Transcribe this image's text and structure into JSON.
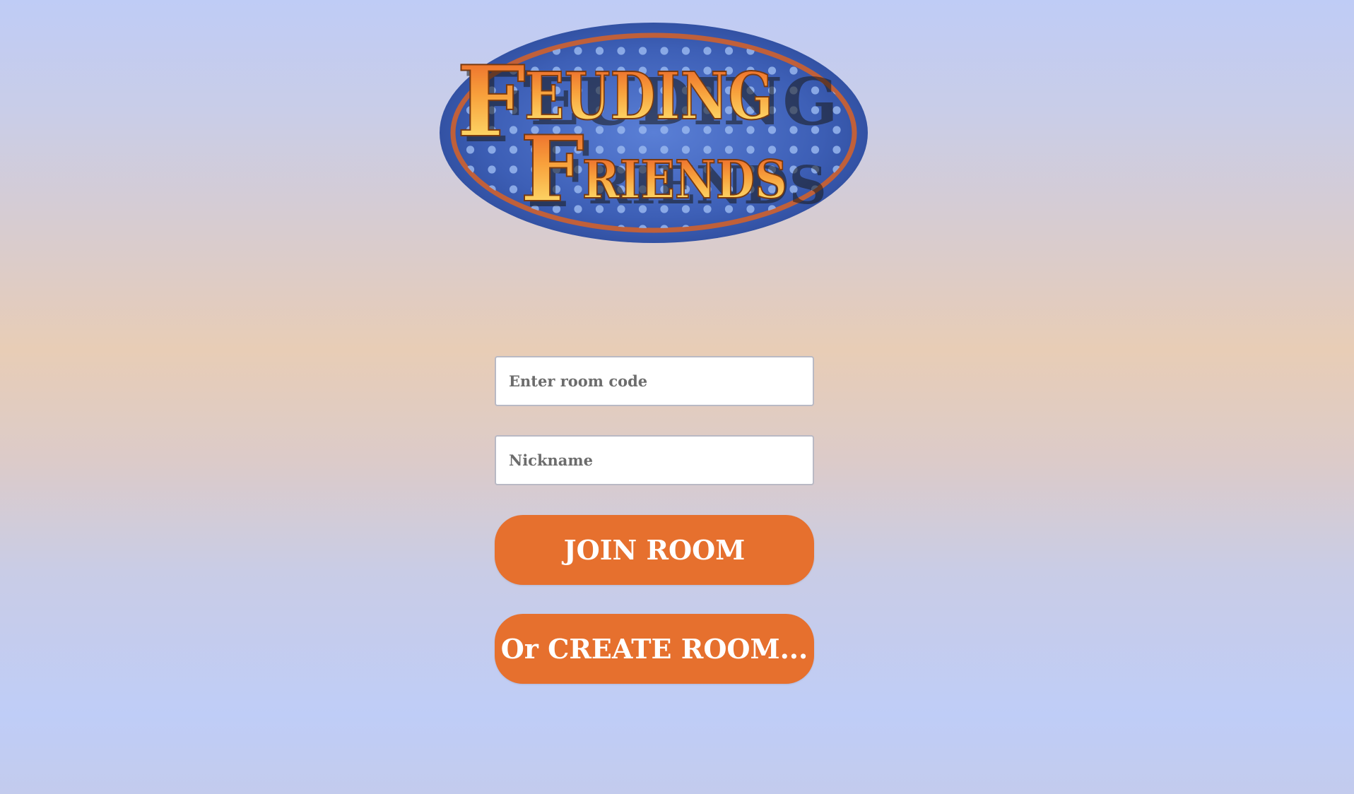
{
  "logo": {
    "line1_initial": "F",
    "line1_rest": "EUDING",
    "line2_initial": "F",
    "line2_rest": "RIENDS",
    "colors": {
      "oval": "#4a6ac0",
      "ring": "#c0603a",
      "dots": "#8fb0ea",
      "text_top": "#ffe060",
      "text_bottom": "#ef6a2a"
    }
  },
  "form": {
    "room_code_placeholder": "Enter room code",
    "room_code_value": "",
    "nickname_placeholder": "Nickname",
    "nickname_value": "",
    "join_label": "JOIN ROOM",
    "create_label": "Or CREATE ROOM..."
  },
  "colors": {
    "button": "#e6702e",
    "button_text": "#ffffff"
  }
}
